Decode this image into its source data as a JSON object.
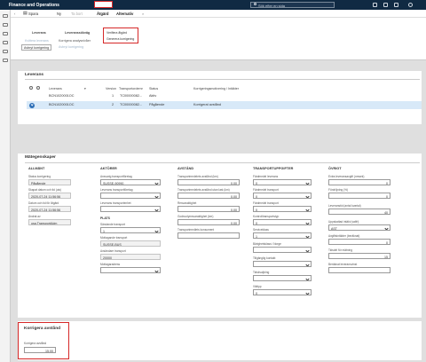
{
  "app": {
    "title": "Finance and Operations",
    "search_placeholder": "Sök efter en sida"
  },
  "toolbar": {
    "save": "Spara",
    "new": "Ny",
    "delete": "Ta bort",
    "tab_active": "Åtgärd",
    "tab_options": "Alternativ"
  },
  "ribbon": {
    "group1_header": "Leverans",
    "group1_item": "Kvittera leverans",
    "group1_button": "Avbryt korrigering",
    "group2_header": "Leveranssökväg",
    "group2_item1": "Korrigera analysnivåer",
    "group2_item2": "Avbryt korrigering"
  },
  "dropdown": {
    "item1": "Verifiera åtgärd",
    "item2": "Generera korrigering"
  },
  "deliveries": {
    "section_title": "Leverans",
    "col_delivery": "Leverans",
    "col_version": "Version",
    "col_transport_order": "Transportordernr",
    "col_status": "Status",
    "col_correction": "Korrigeringsmotivering / Intäkter",
    "rows": [
      {
        "id": "BCN1020001OC",
        "version": "1",
        "order": "TC00000082...",
        "status": "Aktiv",
        "reason": ""
      },
      {
        "id": "BCN1020001OC",
        "version": "2",
        "order": "TC00000082...",
        "status": "Pågående",
        "reason": "Korrigerat avstånd"
      }
    ]
  },
  "details": {
    "section_title": "Mätegenskaper",
    "general": {
      "header": "ALLMÄNT",
      "l1": "Status korrigering",
      "v1": "Pågående",
      "l2": "Skapat datum och tid (utc)",
      "v2": "2020-07-24 11:56:56",
      "l3": "Datum och tid för åtgärd",
      "v3": "2020-07-24 11:56:56",
      "l4": "Ändrat av",
      "v4": "usa.TransportAdm"
    },
    "factors": {
      "header": "AKTÖRER",
      "l1": "Ansvarig transportföretag",
      "v1": "SUSSE-90990",
      "l2": "Leverans transportföretag",
      "v2": "",
      "l3": "Leverans transportenhet",
      "v3": "",
      "sub": "PLATS",
      "l4": "Sändande transport",
      "v4": "1",
      "l5": "Mottagande transport",
      "v5": "SUSSE-BUS",
      "l6": "Avsändare transport",
      "v6": "20000",
      "l7": "Mottagaradress",
      "v7": ""
    },
    "distance": {
      "header": "AVSTÅND",
      "l1": "Transportmedelets avstånd (km)",
      "v1": "0,00",
      "l2": "Transportmedelets avstånd utan last (km)",
      "v2": "0,00",
      "l3": "Resvaraktighet",
      "v3": "0,00",
      "l4": "Godsvolymsvaraktighet (km)",
      "v4": "0,00",
      "l5": "Transportmedlets konsument",
      "v5": ""
    },
    "transport": {
      "header": "TRANSPORTUPPGIFTER",
      "l1": "Färdmedel leverans",
      "v1": "0",
      "l2": "Färdmedel transport",
      "v2": "0",
      "l3": "Färdmedel transport",
      "v3": "0",
      "l4": "Kontrolltransportstyp",
      "v4": "0",
      "l5": "Serviceklass",
      "v5": "1",
      "l6": "Bärighetsklass i Norge",
      "v6": "",
      "l7": "Tillgänglig kontakt",
      "v7": "",
      "l8": "Tidskvaljning",
      "v8": "",
      "l9": "Vikttyp",
      "v9": "0"
    },
    "other": {
      "header": "ÖVRIGT",
      "l1": "Extra leveransavgift (nmsek)",
      "v1": "0",
      "l2": "Fördröjning (%)",
      "v2": "0",
      "l3": "Leveranstid (antal kvartal)",
      "v3": "40",
      "l4": "Uppskattad intäkt (valfri)",
      "v4": "AST",
      "l5": "Avgiftsintäkter (beräknat)",
      "v5": "0",
      "l6": "Tidsdel för mätning",
      "v6": "15",
      "l7": "Beräknat leveransvinst",
      "v7": ""
    }
  },
  "correction": {
    "section_title": "Korrigera avstånd",
    "field_label": "Korrigera avstånd",
    "value": "15,00"
  }
}
